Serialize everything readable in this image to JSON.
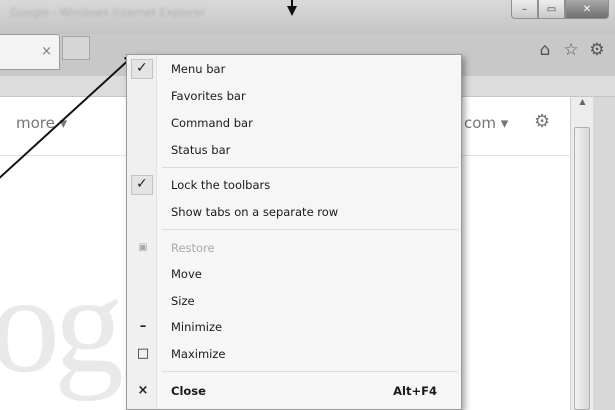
{
  "window": {
    "title": "Google - Windows Internet Explorer",
    "minimize_glyph": "–",
    "maximize_glyph": "▭",
    "close_glyph": "✕"
  },
  "tab": {
    "close_glyph": "×"
  },
  "toolbar_icons": [
    {
      "name": "home-icon",
      "glyph": "⌂"
    },
    {
      "name": "favorites-star-icon",
      "glyph": "☆"
    },
    {
      "name": "tools-gear-icon",
      "glyph": "⚙"
    }
  ],
  "page": {
    "more_label": "more ▾",
    "com_label": "com ▾",
    "gear_glyph": "⚙",
    "logo_fragment": "og"
  },
  "menu": {
    "items": [
      {
        "label": "Menu bar",
        "checked": true,
        "icon": "✓"
      },
      {
        "label": "Favorites bar"
      },
      {
        "label": "Command bar"
      },
      {
        "label": "Status bar"
      },
      {
        "label": "Lock the toolbars",
        "checked": true,
        "icon": "✓"
      },
      {
        "label": "Show tabs on a separate row"
      },
      {
        "label": "Restore",
        "disabled": true,
        "icon": "▣"
      },
      {
        "label": "Move"
      },
      {
        "label": "Size"
      },
      {
        "label": "Minimize",
        "icon": "–"
      },
      {
        "label": "Maximize",
        "icon": "□"
      },
      {
        "label": "Close",
        "icon": "×",
        "shortcut": "Alt+F4"
      }
    ]
  }
}
